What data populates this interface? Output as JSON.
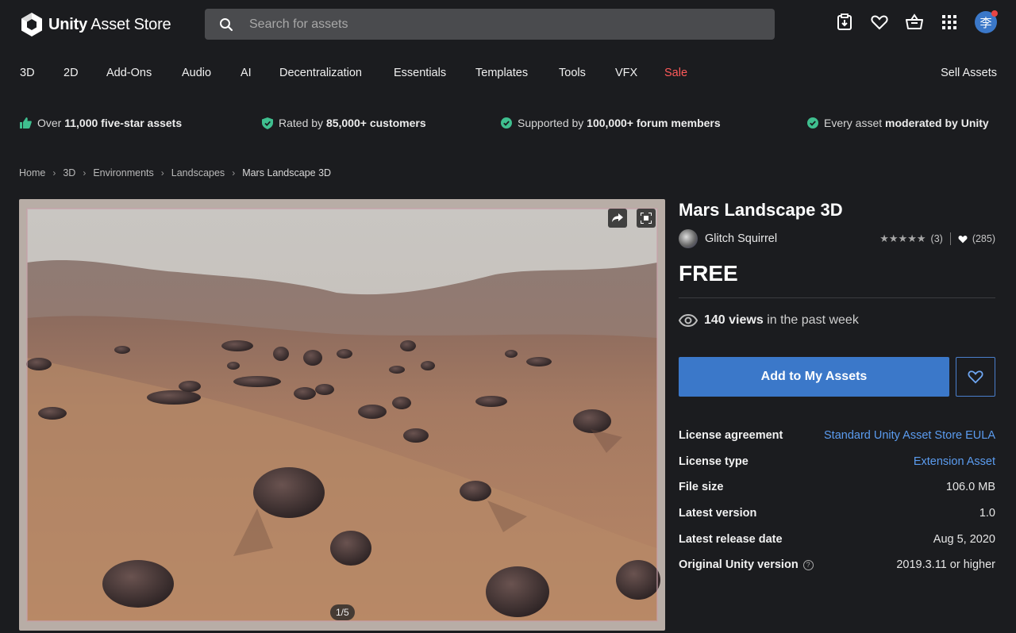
{
  "header": {
    "logo_text_bold": "Unity",
    "logo_text": "Asset Store",
    "search_placeholder": "Search for assets",
    "avatar_char": "李"
  },
  "nav": {
    "items": [
      "3D",
      "2D",
      "Add-Ons",
      "Audio",
      "AI",
      "Decentralization",
      "Essentials",
      "Templates",
      "Tools",
      "VFX",
      "Sale"
    ],
    "sell": "Sell Assets"
  },
  "perks": [
    {
      "pre": "Over ",
      "bold": "11,000 five-star assets",
      "post": ""
    },
    {
      "pre": "Rated by ",
      "bold": "85,000+ customers",
      "post": ""
    },
    {
      "pre": "Supported by ",
      "bold": "100,000+ forum members",
      "post": ""
    },
    {
      "pre": "Every asset ",
      "bold": "moderated by Unity",
      "post": ""
    }
  ],
  "breadcrumb": [
    "Home",
    "3D",
    "Environments",
    "Landscapes",
    "Mars Landscape 3D"
  ],
  "gallery": {
    "counter": "1/5"
  },
  "product": {
    "title": "Mars Landscape 3D",
    "publisher": "Glitch Squirrel",
    "stars": "★★★★★",
    "rating_count": "(3)",
    "favorites": "(285)",
    "price": "FREE",
    "views_bold": "140 views",
    "views_rest": "in the past week",
    "add_button": "Add to My Assets"
  },
  "specs": [
    {
      "key": "License agreement",
      "value": "Standard Unity Asset Store EULA",
      "link": true
    },
    {
      "key": "License type",
      "value": "Extension Asset",
      "link": true
    },
    {
      "key": "File size",
      "value": "106.0 MB",
      "link": false
    },
    {
      "key": "Latest version",
      "value": "1.0",
      "link": false
    },
    {
      "key": "Latest release date",
      "value": "Aug 5, 2020",
      "link": false
    },
    {
      "key": "Original Unity version",
      "value": "2019.3.11 or higher",
      "link": false,
      "help": "?"
    }
  ],
  "colors": {
    "accent": "#3b78c9",
    "link": "#5b9cf0",
    "sale": "#ff5a5a",
    "check": "#3fbf8f"
  }
}
